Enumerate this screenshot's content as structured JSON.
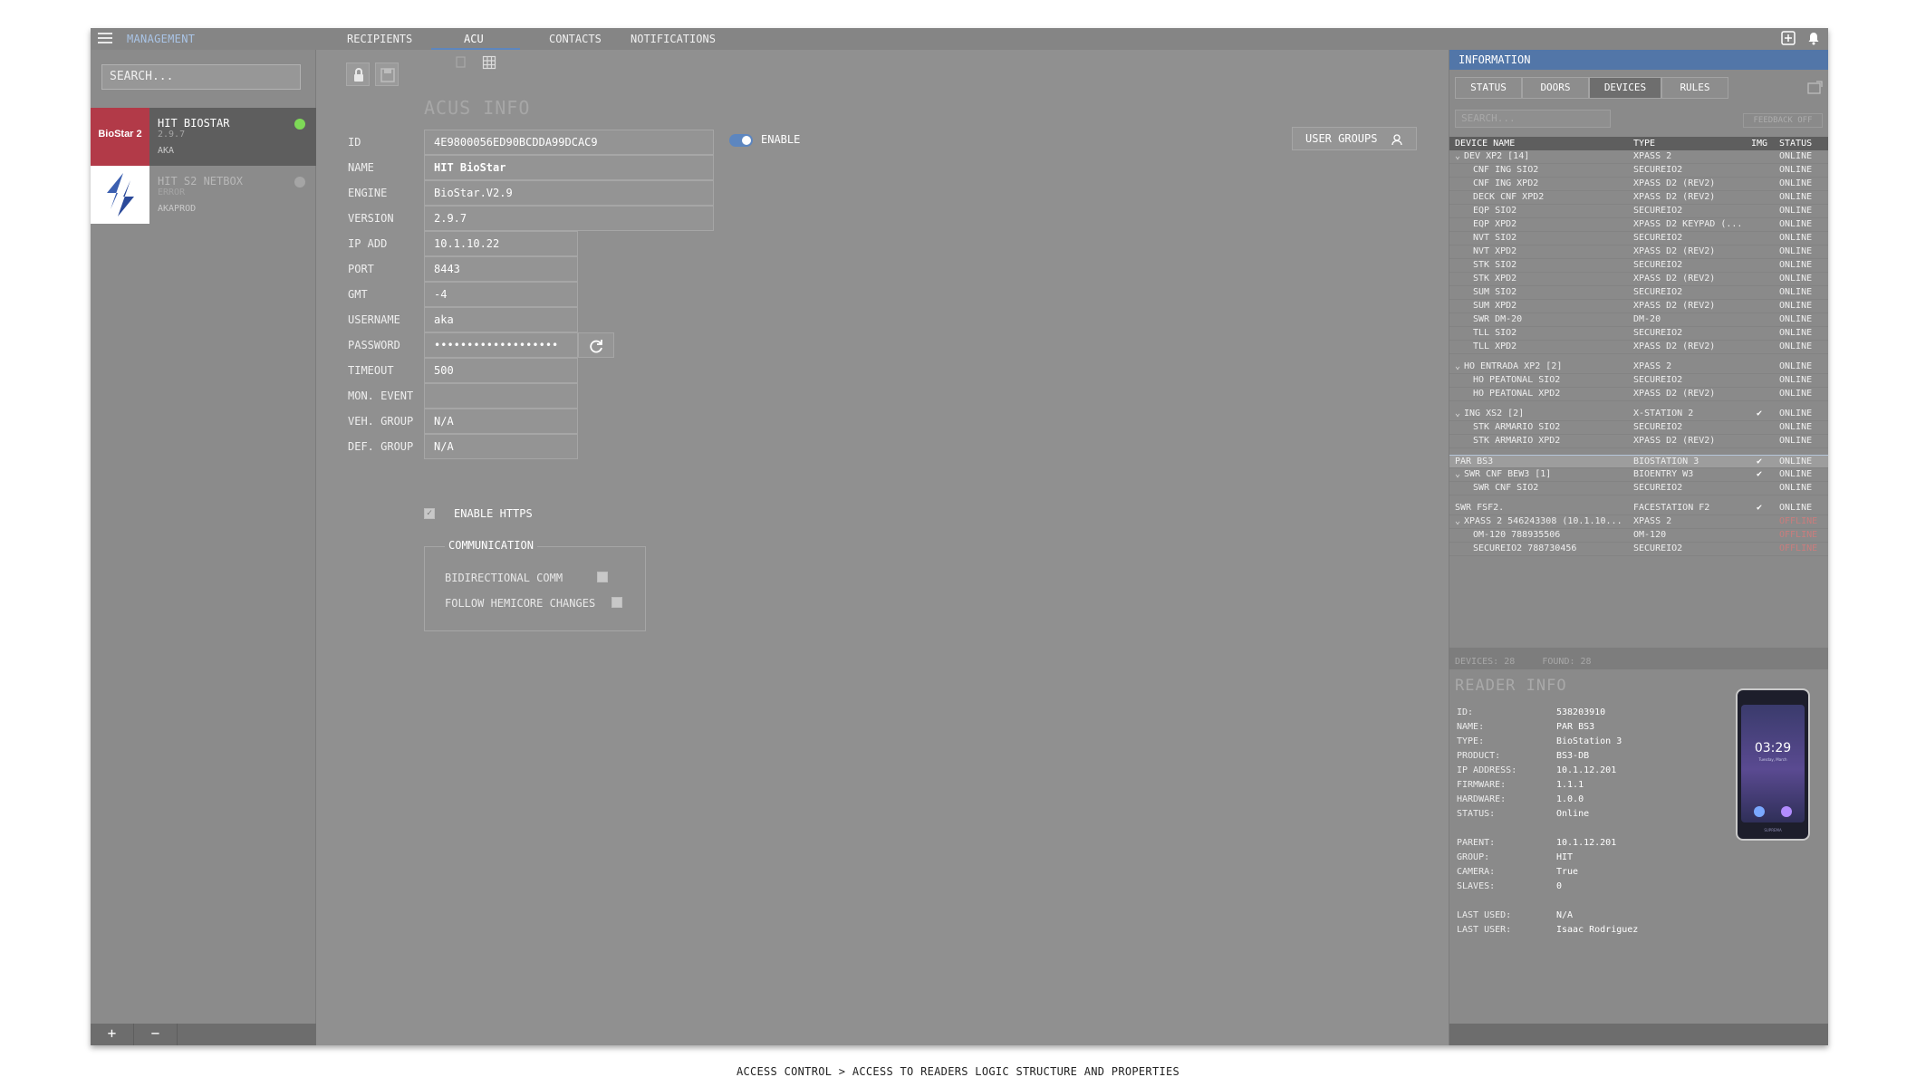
{
  "topbar": {
    "management": "MANAGEMENT",
    "tabs": [
      {
        "label": "RECIPIENTS"
      },
      {
        "label": "ACU"
      },
      {
        "label": "CONTACTS"
      },
      {
        "label": "NOTIFICATIONS"
      }
    ],
    "active_tab": "ACU"
  },
  "left": {
    "search_placeholder": "SEARCH...",
    "acus": [
      {
        "logo_text": "BioStar 2",
        "name": "HIT BIOSTAR",
        "version": "2.9.7",
        "user": "AKA",
        "status_color": "#7ed957"
      },
      {
        "logo_text": "",
        "name": "HIT S2 NETBOX",
        "version": "ERROR",
        "user": "AKAPROD",
        "status_color": "#a5a5a5"
      }
    ],
    "add_label": "+",
    "remove_label": "−"
  },
  "acu": {
    "section_title": "ACUS INFO",
    "fields": [
      {
        "label": "ID",
        "value": "4E9800056ED90BCDDA99DCAC9"
      },
      {
        "label": "NAME",
        "value": "HIT BioStar"
      },
      {
        "label": "ENGINE",
        "value": "BioStar.V2.9"
      },
      {
        "label": "VERSION",
        "value": "2.9.7"
      },
      {
        "label": "IP ADD",
        "value": "10.1.10.22"
      },
      {
        "label": "PORT",
        "value": "8443"
      },
      {
        "label": "GMT",
        "value": "-4"
      },
      {
        "label": "USERNAME",
        "value": "aka"
      },
      {
        "label": "PASSWORD",
        "value": "•••••••••••••••••••"
      },
      {
        "label": "TIMEOUT",
        "value": "500"
      },
      {
        "label": "MON. EVENT",
        "value": ""
      },
      {
        "label": "VEH. GROUP",
        "value": "N/A"
      },
      {
        "label": "DEF. GROUP",
        "value": "N/A"
      }
    ],
    "enable_label": "ENABLE",
    "user_groups_label": "USER GROUPS",
    "enable_https_label": "ENABLE HTTPS",
    "communication": {
      "legend": "COMMUNICATION",
      "items": [
        {
          "label": "BIDIRECTIONAL COMM"
        },
        {
          "label": "FOLLOW HEMICORE CHANGES"
        }
      ]
    }
  },
  "info": {
    "title": "INFORMATION",
    "tabs": [
      {
        "label": "STATUS"
      },
      {
        "label": "DOORS"
      },
      {
        "label": "DEVICES"
      },
      {
        "label": "RULES"
      }
    ],
    "active_tab": "DEVICES",
    "search_placeholder": "SEARCH...",
    "feedback_label": "FEEDBACK OFF",
    "columns": {
      "name": "DEVICE NAME",
      "type": "TYPE",
      "img": "IMG",
      "status": "STATUS"
    },
    "rows": [
      {
        "name": "DEV XP2 [14]",
        "type": "XPASS 2",
        "img": "",
        "status": "ONLINE",
        "level": 0,
        "expand": true
      },
      {
        "name": "CNF ING SIO2",
        "type": "SECUREIO2",
        "img": "",
        "status": "ONLINE",
        "level": 1
      },
      {
        "name": "CNF ING XPD2",
        "type": "XPASS D2 (REV2)",
        "img": "",
        "status": "ONLINE",
        "level": 1
      },
      {
        "name": "DECK CNF XPD2",
        "type": "XPASS D2 (REV2)",
        "img": "",
        "status": "ONLINE",
        "level": 1
      },
      {
        "name": "EQP SIO2",
        "type": "SECUREIO2",
        "img": "",
        "status": "ONLINE",
        "level": 1
      },
      {
        "name": "EQP XPD2",
        "type": "XPASS D2 KEYPAD (...",
        "img": "",
        "status": "ONLINE",
        "level": 1
      },
      {
        "name": "NVT SIO2",
        "type": "SECUREIO2",
        "img": "",
        "status": "ONLINE",
        "level": 1
      },
      {
        "name": "NVT XPD2",
        "type": "XPASS D2 (REV2)",
        "img": "",
        "status": "ONLINE",
        "level": 1
      },
      {
        "name": "STK SIO2",
        "type": "SECUREIO2",
        "img": "",
        "status": "ONLINE",
        "level": 1
      },
      {
        "name": "STK XPD2",
        "type": "XPASS D2 (REV2)",
        "img": "",
        "status": "ONLINE",
        "level": 1
      },
      {
        "name": "SUM SIO2",
        "type": "SECUREIO2",
        "img": "",
        "status": "ONLINE",
        "level": 1
      },
      {
        "name": "SUM XPD2",
        "type": "XPASS D2 (REV2)",
        "img": "",
        "status": "ONLINE",
        "level": 1
      },
      {
        "name": "SWR DM-20",
        "type": "DM-20",
        "img": "",
        "status": "ONLINE",
        "level": 1
      },
      {
        "name": "TLL SIO2",
        "type": "SECUREIO2",
        "img": "",
        "status": "ONLINE",
        "level": 1
      },
      {
        "name": "TLL XPD2",
        "type": "XPASS D2 (REV2)",
        "img": "",
        "status": "ONLINE",
        "level": 1
      },
      {
        "gap": true
      },
      {
        "name": "HO ENTRADA XP2 [2]",
        "type": "XPASS 2",
        "img": "",
        "status": "ONLINE",
        "level": 0,
        "expand": true
      },
      {
        "name": "HO PEATONAL SIO2",
        "type": "SECUREIO2",
        "img": "",
        "status": "ONLINE",
        "level": 1
      },
      {
        "name": "HO PEATONAL XPD2",
        "type": "XPASS D2 (REV2)",
        "img": "",
        "status": "ONLINE",
        "level": 1
      },
      {
        "gap": true
      },
      {
        "name": "ING XS2 [2]",
        "type": "X-STATION 2",
        "img": "✔",
        "status": "ONLINE",
        "level": 0,
        "expand": true
      },
      {
        "name": "STK ARMARIO SIO2",
        "type": "SECUREIO2",
        "img": "",
        "status": "ONLINE",
        "level": 1
      },
      {
        "name": "STK ARMARIO XPD2",
        "type": "XPASS D2 (REV2)",
        "img": "",
        "status": "ONLINE",
        "level": 1
      },
      {
        "gap": true
      },
      {
        "name": "PAR BS3",
        "type": "BIOSTATION 3",
        "img": "✔",
        "status": "ONLINE",
        "level": 0,
        "highlight": true
      },
      {
        "name": "SWR CNF BEW3 [1]",
        "type": "BIOENTRY W3",
        "img": "✔",
        "status": "ONLINE",
        "level": 0,
        "expand": true
      },
      {
        "name": "SWR CNF SIO2",
        "type": "SECUREIO2",
        "img": "",
        "status": "ONLINE",
        "level": 1
      },
      {
        "gap": true
      },
      {
        "name": "SWR FSF2.",
        "type": "FACESTATION F2",
        "img": "✔",
        "status": "ONLINE",
        "level": 0
      },
      {
        "name": "XPASS 2 546243308 (10.1.10...",
        "type": "XPASS 2",
        "img": "",
        "status": "OFFLINE",
        "level": 0,
        "expand": true
      },
      {
        "name": "OM-120 788935506",
        "type": "OM-120",
        "img": "",
        "status": "OFFLINE",
        "level": 1
      },
      {
        "name": "SECUREIO2 788730456",
        "type": "SECUREIO2",
        "img": "",
        "status": "OFFLINE",
        "level": 1
      }
    ],
    "devices_label": "DEVICES:",
    "devices_count": "28",
    "found_label": "FOUND:",
    "found_count": "28",
    "reader": {
      "title": "READER INFO",
      "props": [
        {
          "label": "ID:",
          "value": "538203910"
        },
        {
          "label": "NAME:",
          "value": "PAR BS3"
        },
        {
          "label": "TYPE:",
          "value": "BioStation 3"
        },
        {
          "label": "PRODUCT:",
          "value": "BS3-DB"
        },
        {
          "label": "IP ADDRESS:",
          "value": "10.1.12.201"
        },
        {
          "label": "FIRMWARE:",
          "value": "1.1.1"
        },
        {
          "label": "HARDWARE:",
          "value": "1.0.0"
        },
        {
          "label": "STATUS:",
          "value": "Online"
        },
        {
          "gap": true
        },
        {
          "label": "PARENT:",
          "value": "10.1.12.201"
        },
        {
          "label": "GROUP:",
          "value": "HIT"
        },
        {
          "label": "CAMERA:",
          "value": "True"
        },
        {
          "label": "SLAVES:",
          "value": "0"
        },
        {
          "gap": true
        },
        {
          "label": "LAST USED:",
          "value": "N/A"
        },
        {
          "label": "LAST USER:",
          "value": "Isaac Rodriguez"
        }
      ],
      "device_time": "03:29",
      "device_date": "Tuesday, March",
      "device_brand": "SUPREMA"
    }
  },
  "caption": "ACCESS CONTROL > ACCESS TO READERS LOGIC STRUCTURE AND PROPERTIES"
}
